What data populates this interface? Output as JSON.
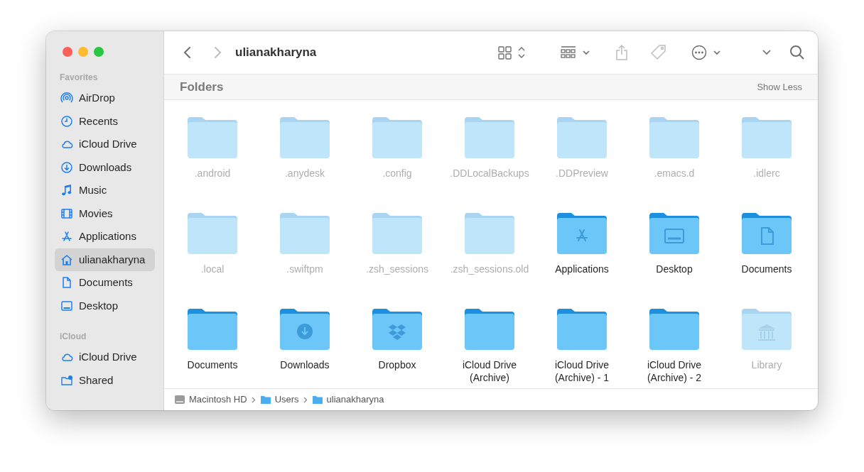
{
  "window": {
    "title": "ulianakharyna"
  },
  "toolbar": {
    "buttons": [
      {
        "kind": "back",
        "disabled": false
      },
      {
        "kind": "forward",
        "disabled": true
      },
      {
        "kind": "view",
        "disabled": false
      },
      {
        "kind": "group",
        "disabled": false
      },
      {
        "kind": "share",
        "disabled": true
      },
      {
        "kind": "tag",
        "disabled": true
      },
      {
        "kind": "more",
        "disabled": false
      },
      {
        "kind": "chevron",
        "disabled": false
      },
      {
        "kind": "search",
        "disabled": false
      }
    ]
  },
  "sidebar": {
    "sections": [
      {
        "title": "Favorites",
        "items": [
          {
            "label": "AirDrop",
            "kind": "airdrop",
            "selected": false
          },
          {
            "label": "Recents",
            "kind": "clock",
            "selected": false
          },
          {
            "label": "iCloud Drive",
            "kind": "cloud",
            "selected": false
          },
          {
            "label": "Downloads",
            "kind": "download",
            "selected": false
          },
          {
            "label": "Music",
            "kind": "music",
            "selected": false
          },
          {
            "label": "Movies",
            "kind": "film",
            "selected": false
          },
          {
            "label": "Applications",
            "kind": "apps",
            "selected": false
          },
          {
            "label": "ulianakharyna",
            "kind": "home",
            "selected": true
          },
          {
            "label": "Documents",
            "kind": "document",
            "selected": false
          },
          {
            "label": "Desktop",
            "kind": "desktop",
            "selected": false
          }
        ]
      },
      {
        "title": "iCloud",
        "items": [
          {
            "label": "iCloud Drive",
            "kind": "cloud",
            "selected": false
          },
          {
            "label": "Shared",
            "kind": "shared",
            "selected": false
          }
        ]
      }
    ]
  },
  "section": {
    "title": "Folders",
    "action": "Show Less"
  },
  "folders": [
    {
      "name": ".android",
      "hidden": true,
      "kind": "plain"
    },
    {
      "name": ".anydesk",
      "hidden": true,
      "kind": "plain"
    },
    {
      "name": ".config",
      "hidden": true,
      "kind": "plain"
    },
    {
      "name": ".DDLocalBackups",
      "hidden": true,
      "kind": "plain"
    },
    {
      "name": ".DDPreview",
      "hidden": true,
      "kind": "plain"
    },
    {
      "name": ".emacs.d",
      "hidden": true,
      "kind": "plain"
    },
    {
      "name": ".idlerc",
      "hidden": true,
      "kind": "plain"
    },
    {
      "name": ".local",
      "hidden": true,
      "kind": "plain"
    },
    {
      "name": ".swiftpm",
      "hidden": true,
      "kind": "plain"
    },
    {
      "name": ".zsh_sessions",
      "hidden": true,
      "kind": "plain"
    },
    {
      "name": ".zsh_sessions.old",
      "hidden": true,
      "kind": "plain"
    },
    {
      "name": "Applications",
      "hidden": false,
      "kind": "apps"
    },
    {
      "name": "Desktop",
      "hidden": false,
      "kind": "desktop"
    },
    {
      "name": "Documents",
      "hidden": false,
      "kind": "document"
    },
    {
      "name": "Documents",
      "hidden": false,
      "kind": "plain"
    },
    {
      "name": "Downloads",
      "hidden": false,
      "kind": "download"
    },
    {
      "name": "Dropbox",
      "hidden": false,
      "kind": "dropbox"
    },
    {
      "name": "iCloud Drive (Archive)",
      "hidden": false,
      "kind": "plain"
    },
    {
      "name": "iCloud Drive (Archive) - 1",
      "hidden": false,
      "kind": "plain"
    },
    {
      "name": "iCloud Drive (Archive) - 2",
      "hidden": false,
      "kind": "plain"
    },
    {
      "name": "Library",
      "hidden": true,
      "kind": "library"
    }
  ],
  "path_bar": [
    {
      "label": "Macintosh HD",
      "kind": "disk"
    },
    {
      "label": "Users",
      "kind": "folder"
    },
    {
      "label": "ulianakharyna",
      "kind": "folder"
    }
  ]
}
